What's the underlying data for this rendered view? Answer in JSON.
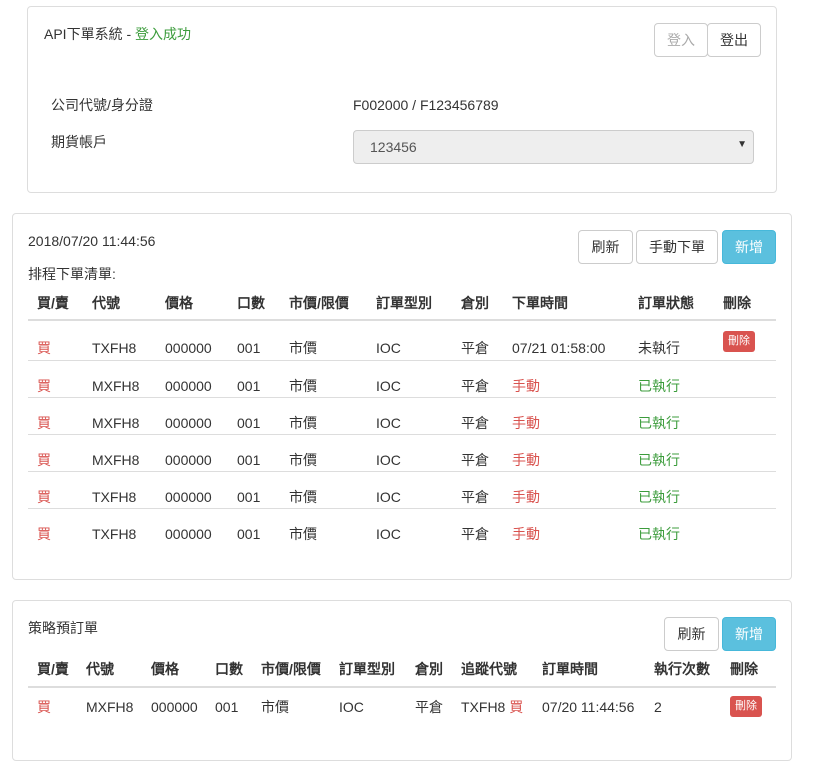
{
  "login_panel": {
    "system_title": "API下單系統 - ",
    "status": "登入成功",
    "login_button": "登入",
    "logout_button": "登出",
    "company_id_label": "公司代號/身分證",
    "company_id_value": "F002000 / F123456789",
    "futures_account_label": "期貨帳戶",
    "futures_account_value": "123456"
  },
  "schedule_panel": {
    "timestamp": "2018/07/20 11:44:56",
    "list_title": "排程下單清單:",
    "refresh_button": "刷新",
    "manual_order_button": "手動下單",
    "add_button": "新增",
    "columns": [
      "買/賣",
      "代號",
      "價格",
      "口數",
      "市價/限價",
      "訂單型別",
      "倉別",
      "下單時間",
      "訂單狀態",
      "刪除"
    ],
    "rows": [
      {
        "side": "買",
        "code": "TXFH8",
        "price": "000000",
        "qty": "001",
        "price_type": "市價",
        "order_type": "IOC",
        "position": "平倉",
        "order_time": "07/21 01:58:00",
        "status": "未執行",
        "delete": "刪除"
      },
      {
        "side": "買",
        "code": "MXFH8",
        "price": "000000",
        "qty": "001",
        "price_type": "市價",
        "order_type": "IOC",
        "position": "平倉",
        "order_time": "手動",
        "status": "已執行",
        "delete": ""
      },
      {
        "side": "買",
        "code": "MXFH8",
        "price": "000000",
        "qty": "001",
        "price_type": "市價",
        "order_type": "IOC",
        "position": "平倉",
        "order_time": "手動",
        "status": "已執行",
        "delete": ""
      },
      {
        "side": "買",
        "code": "MXFH8",
        "price": "000000",
        "qty": "001",
        "price_type": "市價",
        "order_type": "IOC",
        "position": "平倉",
        "order_time": "手動",
        "status": "已執行",
        "delete": ""
      },
      {
        "side": "買",
        "code": "TXFH8",
        "price": "000000",
        "qty": "001",
        "price_type": "市價",
        "order_type": "IOC",
        "position": "平倉",
        "order_time": "手動",
        "status": "已執行",
        "delete": ""
      },
      {
        "side": "買",
        "code": "TXFH8",
        "price": "000000",
        "qty": "001",
        "price_type": "市價",
        "order_type": "IOC",
        "position": "平倉",
        "order_time": "手動",
        "status": "已執行",
        "delete": ""
      }
    ]
  },
  "strategy_panel": {
    "title": "策略預訂單",
    "refresh_button": "刷新",
    "add_button": "新增",
    "columns": [
      "買/賣",
      "代號",
      "價格",
      "口數",
      "市價/限價",
      "訂單型別",
      "倉別",
      "追蹤代號",
      "訂單時間",
      "執行次數",
      "刪除"
    ],
    "rows": [
      {
        "side": "買",
        "code": "MXFH8",
        "price": "000000",
        "qty": "001",
        "price_type": "市價",
        "order_type": "IOC",
        "position": "平倉",
        "track_code": "TXFH8",
        "track_side": "買",
        "order_time": "07/20 11:44:56",
        "exec_count": "2",
        "delete": "刪除"
      }
    ]
  },
  "colors": {
    "success_green": "#3c9c3c",
    "danger_red": "#d9534f",
    "info_blue": "#5bc0de",
    "border_gray": "#dddddd"
  }
}
